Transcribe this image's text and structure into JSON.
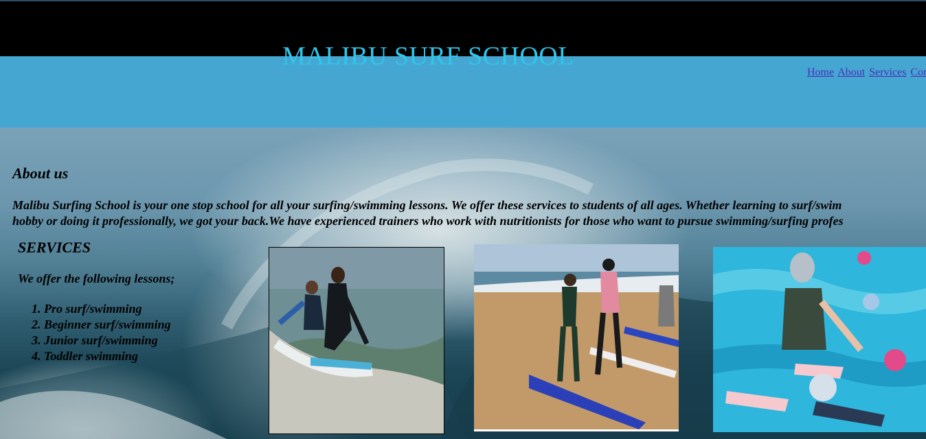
{
  "header": {
    "title": "MALIBU SURF SCHOOL",
    "nav": [
      "Home",
      "About",
      "Services",
      "Con"
    ]
  },
  "about": {
    "heading": "About us",
    "line1": "Malibu Surfing School is your one stop school for all your surfing/swimming lessons. We offer these services to students of all ages. Whether learning to surf/swim",
    "line2": "hobby or doing it professionally, we got your back.We have experienced trainers who work with nutritionists for those who want to pursue swimming/surfing profes"
  },
  "services": {
    "heading": "SERVICES",
    "intro": "We offer the following lessons;",
    "lessons": [
      "1. Pro surf/swimming",
      "2. Beginner surf/swimming",
      "3. Junior surf/swimming",
      "4. Toddler swimming"
    ]
  },
  "photos": [
    {
      "icon": "surf-lesson-photo"
    },
    {
      "icon": "beach-lesson-photo"
    },
    {
      "icon": "swimming-lesson-photo"
    }
  ],
  "colors": {
    "topbar": "#000000",
    "header": "#46a6d2",
    "title": "#2fc6ea",
    "nav_link": "#4a2fb8"
  }
}
